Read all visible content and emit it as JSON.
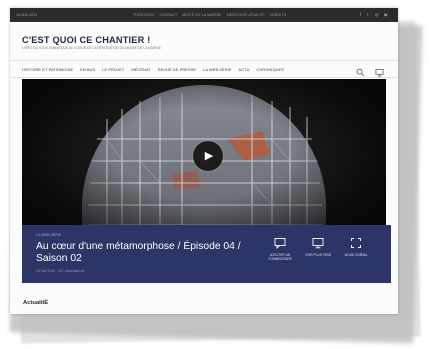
{
  "topbar": {
    "date": "18 MAI 2024",
    "links": [
      "POSITIONS",
      "CONTACT",
      "MUS É DE LA MARINE",
      "MENTIONS LÉGALES",
      "CRÉDITS"
    ],
    "social_icons": [
      "facebook-icon",
      "twitter-icon",
      "instagram-icon",
      "youtube-icon"
    ]
  },
  "header": {
    "title": "C'EST QUOI CE CHANTIER !",
    "tagline": "L'INFO DU VOUS EMBARQUE AU COEUR DE LA RÉNOVATION DU MUSÉE DE LA MARINE"
  },
  "nav": {
    "items": [
      "HISTOIRE ET PATRIMOINE",
      "EN BUS",
      "LE PROJET",
      "MÉCÉNAT",
      "REVUE DE PRESSE",
      "LA WEB SÉRIE",
      "ACTU",
      "CHRONIQUES"
    ],
    "search_icon": "search-icon",
    "display_icon": "monitor-icon"
  },
  "episode": {
    "meta_top": "LA WEB SÉRIE",
    "title": "Au cœur d'une métamorphose / Épisode 04 / Saison 02",
    "meta_bottom": "18 mai 2024 · 130 visualisations",
    "actions": [
      {
        "label": "AJOUTER UN COMMENTAIRE",
        "icon": "comment-icon"
      },
      {
        "label": "VOIR PLUS TARD",
        "icon": "monitor-icon"
      },
      {
        "label": "MODE CINÉMA",
        "icon": "expand-icon"
      }
    ]
  },
  "section": {
    "title": "ActualitÉ"
  },
  "colors": {
    "topbar": "#2b2c2e",
    "brand": "#1e2a44",
    "info_panel": "#2d3566"
  }
}
